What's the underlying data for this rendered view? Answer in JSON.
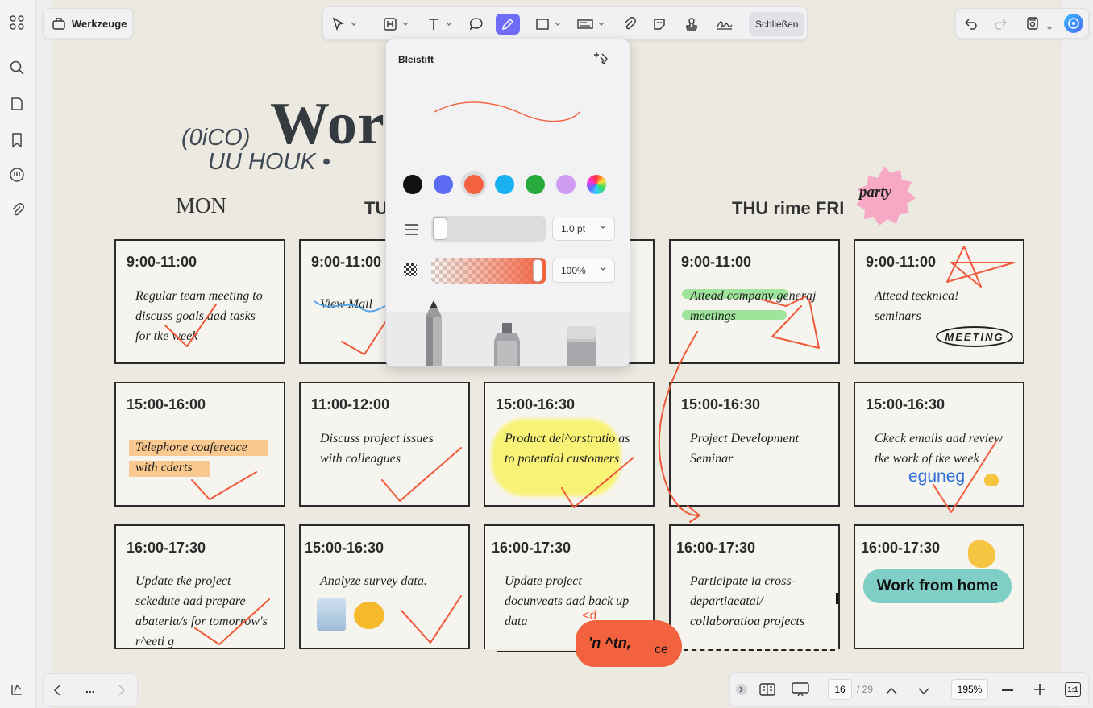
{
  "toolbar": {
    "tools_label": "Werkzeuge",
    "close_label": "Schließen"
  },
  "popup": {
    "title": "Bleistift",
    "colors": [
      "#111111",
      "#5b6cf2",
      "#f2623e",
      "#19b2f0",
      "#29aa3c",
      "#cf9cf2"
    ],
    "selected_color": "#f2623e",
    "thickness": "1.0 pt",
    "opacity": "100%"
  },
  "planner": {
    "title": "Wor",
    "scribble_line1": "(0iCO)",
    "scribble_line2": "UU HOUK •",
    "days": {
      "mon": "MON",
      "tue": "TU",
      "thu_fri": "THU rime FRI"
    },
    "sticker_party": "party",
    "rows": [
      [
        {
          "time": "9:00-11:00",
          "task": "Regular team meeting to discuss goals aad tasks for tke week"
        },
        {
          "time": "9:00-11:00",
          "task": "View Mail"
        },
        {
          "time": "",
          "task": ""
        },
        {
          "time": "9:00-11:00",
          "task": "Attead company generaj meetings"
        },
        {
          "time": "9:00-11:00",
          "task": "Attead tecknica! seminars"
        }
      ],
      [
        {
          "time": "15:00-16:00",
          "task": "Telephone coafereace with cderts"
        },
        {
          "time": "11:00-12:00",
          "task": "Discuss project issues with colleagues"
        },
        {
          "time": "15:00-16:30",
          "task": "Product dei^orstratio as to potential customers"
        },
        {
          "time": "15:00-16:30",
          "task": "Project Development Seminar"
        },
        {
          "time": "15:00-16:30",
          "task": "Ckeck emails aad review tke work of tke week"
        }
      ],
      [
        {
          "time": "16:00-17:30",
          "task": "Update tke project sckedute aad prepare abateria/s for tomorrow's r^eeti g"
        },
        {
          "time": "15:00-16:30",
          "task": "Analyze survey data."
        },
        {
          "time": "16:00-17:30",
          "task": "Update project docunveats aad back up data"
        },
        {
          "time": "16:00-17:30",
          "task": "Participate ia cross-departiaeatai/ collaboratioa projects"
        },
        {
          "time": "16:00-17:30",
          "task": ""
        }
      ]
    ],
    "stamp_meeting": "MEETING",
    "sticker_eguneg": "eguneg",
    "sticker_wfh": "Work from home",
    "blob_text1": "'n ^tn,",
    "blob_text2": "ce",
    "blob_text3": "<d"
  },
  "pagination": {
    "current": "16",
    "total": "/ 29",
    "zoom": "195%",
    "more": "...",
    "fit": "1:1"
  }
}
